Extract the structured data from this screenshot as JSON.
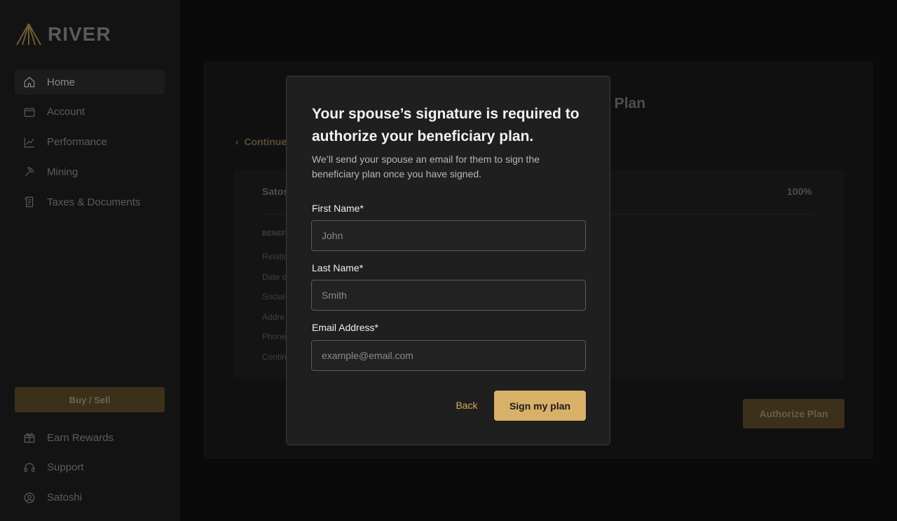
{
  "brand": {
    "name": "RIVER",
    "accent": "#d8b068"
  },
  "sidebar": {
    "items": [
      {
        "label": "Home",
        "icon": "home-icon"
      },
      {
        "label": "Account",
        "icon": "wallet-icon"
      },
      {
        "label": "Performance",
        "icon": "chart-line-icon"
      },
      {
        "label": "Mining",
        "icon": "pickaxe-icon"
      },
      {
        "label": "Taxes & Documents",
        "icon": "documents-icon"
      }
    ],
    "buy_sell_label": "Buy / Sell",
    "bottom_items": [
      {
        "label": "Earn Rewards",
        "icon": "gift-icon"
      },
      {
        "label": "Support",
        "icon": "headset-icon"
      },
      {
        "label": "Satoshi",
        "icon": "user-circle-icon"
      }
    ]
  },
  "background": {
    "title_fragment": "ry Plan",
    "continue_fragment": "Continue",
    "beneficiary_name_fragment": "Satos",
    "percentage": "100%",
    "section_heading_fragment": "BENEF",
    "row_fragments": [
      "Relatio",
      "Date o",
      "Social",
      "Addre",
      "Phone",
      "Contin"
    ],
    "authorize_label": "Authorize Plan"
  },
  "modal": {
    "title": "Your spouse’s signature is required to authorize your beneficiary plan.",
    "description": "We’ll send your spouse an email for them to sign the beneficiary plan once you have signed.",
    "fields": [
      {
        "label": "First Name*",
        "placeholder": "John",
        "value": ""
      },
      {
        "label": "Last Name*",
        "placeholder": "Smith",
        "value": ""
      },
      {
        "label": "Email Address*",
        "placeholder": "example@email.com",
        "value": ""
      }
    ],
    "back_label": "Back",
    "submit_label": "Sign my plan"
  }
}
